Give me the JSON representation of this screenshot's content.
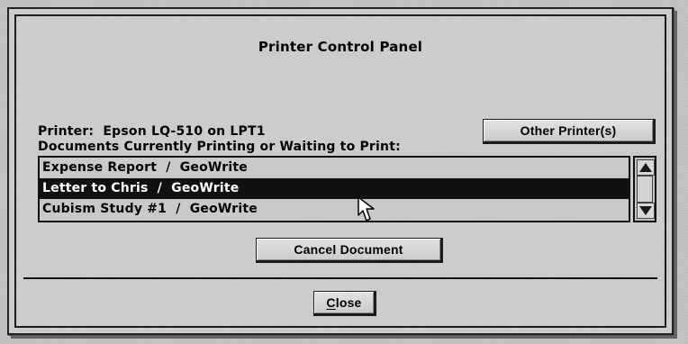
{
  "dialog": {
    "title": "Printer Control Panel"
  },
  "printer": {
    "label": "Printer:  Epson LQ-510 on LPT1"
  },
  "buttons": {
    "other_printers": "Other Printer(s)",
    "cancel_document": "Cancel Document",
    "close_first": "C",
    "close_rest": "lose"
  },
  "documents": {
    "label": "Documents Currently Printing or Waiting to Print:",
    "items": [
      {
        "label": "Expense Report  /  GeoWrite",
        "selected": false
      },
      {
        "label": "Letter to Chris  /  GeoWrite",
        "selected": true
      },
      {
        "label": "Cubism Study #1  /  GeoWrite",
        "selected": false
      }
    ]
  },
  "icons": {
    "scroll_up": "up-arrow-icon",
    "scroll_down": "down-arrow-icon",
    "cursor": "mouse-pointer-icon"
  },
  "colors": {
    "background": "#c7c7c7",
    "selected_row": "#111111",
    "selected_text": "#ffffff",
    "button_face": "#dcdcdc"
  }
}
